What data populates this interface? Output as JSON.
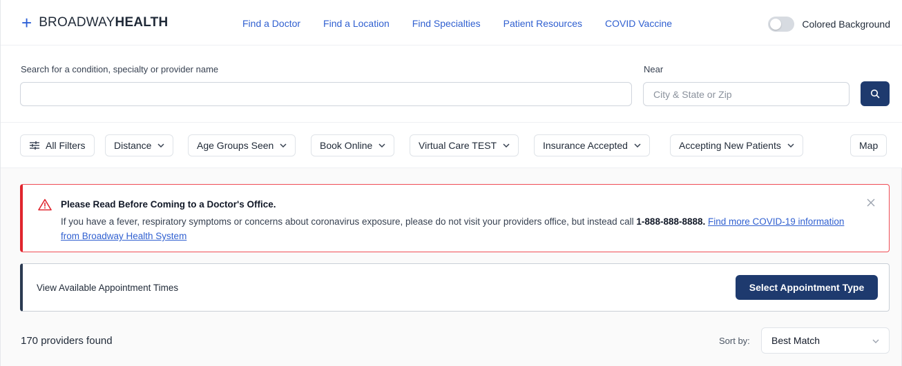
{
  "header": {
    "logo_light": "BROADWAY",
    "logo_bold": "HEALTH",
    "nav": [
      "Find a Doctor",
      "Find a Location",
      "Find Specialties",
      "Patient Resources",
      "COVID Vaccine"
    ],
    "toggle_label": "Colored Background",
    "toggle_on": false
  },
  "search": {
    "query_label": "Search for a condition, specialty or provider name",
    "query_value": "",
    "near_label": "Near",
    "near_placeholder": "City & State or Zip"
  },
  "filters": {
    "all_filters": "All Filters",
    "distance": "Distance",
    "age_groups": "Age Groups Seen",
    "book_online": "Book Online",
    "virtual_care": "Virtual Care TEST",
    "insurance": "Insurance Accepted",
    "accepting": "Accepting New Patients",
    "map": "Map"
  },
  "alert": {
    "title": "Please Read Before Coming to a Doctor's Office.",
    "body_start": "If you have a fever, respiratory symptoms or concerns about coronavirus exposure, please do not visit your providers office, but instead call ",
    "phone": "1-888-888-8888.",
    "link": "Find more COVID-19 information from Broadway Health System"
  },
  "appointment": {
    "text": "View Available Appointment Times",
    "button": "Select Appointment Type"
  },
  "results": {
    "count": "170 providers found",
    "sort_label": "Sort by:",
    "sort_value": "Best Match"
  },
  "colors": {
    "brand_blue": "#2b5ed6",
    "link_blue": "#2f5fd0",
    "navy": "#1e3a6e",
    "alert_red": "#e0252e"
  }
}
